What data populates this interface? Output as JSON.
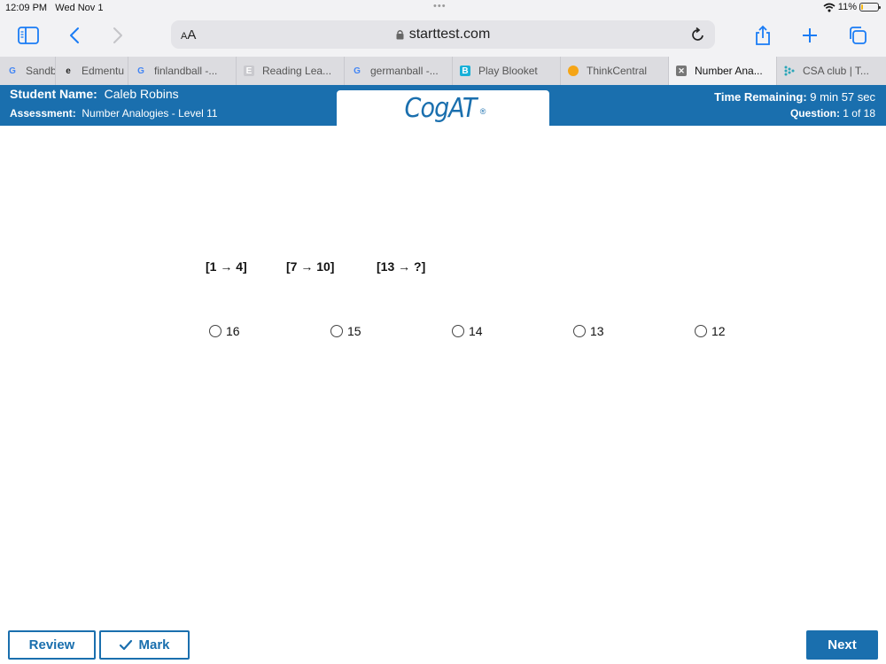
{
  "status_bar": {
    "time": "12:09 PM",
    "date": "Wed Nov 1",
    "battery": "11%",
    "battery_level": 0.11,
    "icons": [
      "wifi-icon",
      "battery-icon"
    ]
  },
  "toolbar": {
    "text_size_label_small": "A",
    "text_size_label_large": "A",
    "url": "starttest.com",
    "icons": [
      "sidebar-icon",
      "back-icon",
      "forward-icon",
      "lock-icon",
      "reload-icon",
      "share-icon",
      "new-tab-icon",
      "tabs-overview-icon"
    ]
  },
  "tabs": [
    {
      "label": "Sandb",
      "favicon": "G"
    },
    {
      "label": "Edmentu",
      "favicon": "e"
    },
    {
      "label": "finlandball -...",
      "favicon": "G"
    },
    {
      "label": "Reading Lea...",
      "favicon": "E"
    },
    {
      "label": "germanball -...",
      "favicon": "G"
    },
    {
      "label": "Play Blooket",
      "favicon": "B"
    },
    {
      "label": "ThinkCentral",
      "favicon": ""
    },
    {
      "label": "Number Ana...",
      "favicon": ""
    },
    {
      "label": "CSA club | T...",
      "favicon": ""
    }
  ],
  "header": {
    "student_label": "Student Name:",
    "student_name": "Caleb Robins",
    "assessment_label": "Assessment:",
    "assessment_name": "Number Analogies - Level 11",
    "time_label": "Time Remaining:",
    "time_value": "9 min 57 sec",
    "question_label": "Question:",
    "question_value": "1 of 18",
    "logo_text": "CogAT",
    "logo_mark": "®",
    "brand_color": "#1a6fae"
  },
  "question": {
    "terms": [
      "[1 → 4]",
      "[7 → 10]",
      "[13 → ?]"
    ],
    "options": [
      "16",
      "15",
      "14",
      "13",
      "12"
    ]
  },
  "footer": {
    "review_label": "Review",
    "mark_label": "Mark",
    "next_label": "Next"
  }
}
